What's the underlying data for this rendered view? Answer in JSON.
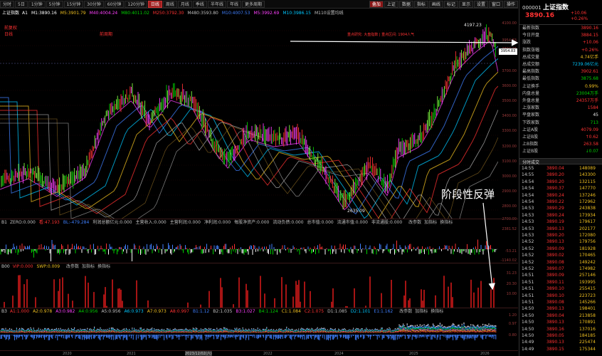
{
  "toolbar": {
    "periods": [
      "分时",
      "5日",
      "1分钟",
      "5分钟",
      "15分钟",
      "30分钟",
      "60分钟",
      "120分钟",
      "日线",
      "周线",
      "月线",
      "季线",
      "半年线",
      "年线",
      "更多周期"
    ],
    "active_period": "日线",
    "right_buttons": [
      "叠加",
      "上证",
      "数据",
      "指标",
      "画线",
      "标记",
      "显示",
      "设置",
      "窗口",
      "操作"
    ]
  },
  "ma_line": {
    "title": "上证指数",
    "items": [
      {
        "label": "A1",
        "value": "",
        "color": "#ffffff"
      },
      {
        "label": "M1:3890.16",
        "color": "#ffffff"
      },
      {
        "label": "M5:3901.79",
        "color": "#f0c020"
      },
      {
        "label": "M40:4004.24",
        "color": "#ff40ff"
      },
      {
        "label": "M80:4011.02",
        "color": "#00d000"
      },
      {
        "label": "M250:3792.30",
        "color": "#ff3232"
      },
      {
        "label": "M480:3593.80",
        "color": "#c0c0c0"
      },
      {
        "label": "M10:4007.53",
        "color": "#4080ff"
      },
      {
        "label": "M5:3992.69",
        "color": "#ff40ff"
      },
      {
        "label": "M10:3986.15",
        "color": "#00c8ff"
      },
      {
        "label": "M110设置均线",
        "color": "#c0c0c0"
      }
    ]
  },
  "main_chart": {
    "left_labels": [
      "前复权",
      "日线",
      "前周期"
    ],
    "top_annotations": [
      {
        "text": "4197.23",
        "color": "#ffffff"
      },
      {
        "text": "重点研究: 大盘指数 | 重点区间: 1904人气",
        "color": "#ff3232"
      }
    ],
    "low_annotation": "2635.09",
    "y_ticks": [
      "4100.00",
      "3954.83",
      "3890.16",
      "3700.00",
      "3600.00",
      "3500.00",
      "3400.00",
      "3300.00",
      "3200.00",
      "3100.00",
      "3000.00",
      "2900.00",
      "2800.00",
      "2700.00"
    ],
    "price_badge": "3954.83",
    "current_price_label": "3890.16",
    "annotation_text": "阶段性反弹"
  },
  "panel_b1": {
    "label": "B1",
    "items": [
      {
        "label": "ZERO:0.000",
        "color": "#c0c0c0"
      },
      {
        "label": "看:47.193",
        "color": "#ff3232"
      },
      {
        "label": "BL:-479.284",
        "color": "#4080ff"
      },
      {
        "label": "利润总额亿元:0.000",
        "color": "#c0c0c0"
      },
      {
        "label": "主营收入:0.000",
        "color": "#c0c0c0"
      },
      {
        "label": "主营利润:0.000",
        "color": "#c0c0c0"
      },
      {
        "label": "净利润:0.000",
        "color": "#c0c0c0"
      },
      {
        "label": "每股净资产:0.000",
        "color": "#c0c0c0"
      },
      {
        "label": "流动负债:0.000",
        "color": "#c0c0c0"
      },
      {
        "label": "总市值:0.000",
        "color": "#c0c0c0"
      },
      {
        "label": "流通市值:0.000",
        "color": "#c0c0c0"
      },
      {
        "label": "非流通股:0.000",
        "color": "#c0c0c0"
      }
    ],
    "controls": [
      "改参数",
      "加指标",
      "换指标"
    ],
    "y_ticks": [
      "2381.52",
      "-53.21",
      "-1140.02"
    ]
  },
  "panel_b00": {
    "label": "B00",
    "items": [
      {
        "label": "VIP:0.000",
        "color": "#ff3232"
      },
      {
        "label": "SWP:0.009",
        "color": "#f0c020"
      }
    ],
    "controls": [
      "改参数",
      "加指标",
      "换指标"
    ],
    "y_ticks": [
      "31.23",
      "20.30",
      "10.00"
    ]
  },
  "panel_b3": {
    "label": "B3",
    "items": [
      {
        "label": "A1:1.000",
        "color": "#ff3232"
      },
      {
        "label": "A2:0.978",
        "color": "#f0c020"
      },
      {
        "label": "A3:0.982",
        "color": "#ff40ff"
      },
      {
        "label": "A4:0.956",
        "color": "#00d000"
      },
      {
        "label": "A5:0.956",
        "color": "#c0c0c0"
      },
      {
        "label": "A6:0.973",
        "color": "#00c8ff"
      },
      {
        "label": "A7:0.973",
        "color": "#f0c020"
      },
      {
        "label": "A8:0.997",
        "color": "#ff3232"
      },
      {
        "label": "B1:1.12",
        "color": "#4080ff"
      },
      {
        "label": "B2:1.035",
        "color": "#c0c0c0"
      },
      {
        "label": "B3:1.027",
        "color": "#ff40ff"
      },
      {
        "label": "B4:1.124",
        "color": "#00d000"
      },
      {
        "label": "C1:1.084",
        "color": "#f0c020"
      },
      {
        "label": "C2:1.075",
        "color": "#ff3232"
      },
      {
        "label": "D1:1.085",
        "color": "#c0c0c0"
      },
      {
        "label": "D2:1.101",
        "color": "#00c8ff"
      },
      {
        "label": "E1:1.162",
        "color": "#4080ff"
      }
    ],
    "controls": [
      "改参数",
      "加指标",
      "换指标"
    ],
    "y_ticks": [
      "1.20",
      "0.97",
      "0.80"
    ]
  },
  "x_axis_labels": [
    "2020",
    "2021",
    "2023/12/02(六)",
    "2022",
    "2024",
    "2025",
    "2026"
  ],
  "quote": {
    "code": "000001",
    "name": "上证指数",
    "price": "3890.16",
    "change": "+10.06",
    "change_pct": "+0.26%",
    "rows": [
      {
        "k": "最新指数",
        "v": "3890.16",
        "c": "red"
      },
      {
        "k": "今日开盘",
        "v": "3884.15",
        "c": "red"
      },
      {
        "k": "涨跌",
        "v": "+10.06",
        "c": "red"
      },
      {
        "k": "指数涨幅",
        "v": "+0.26%",
        "c": "red"
      },
      {
        "k": "总成交量",
        "v": "4.74亿手",
        "c": "yellow"
      },
      {
        "k": "总成交额",
        "v": "7239.06亿元",
        "c": "cyan"
      },
      {
        "k": "最高指数",
        "v": "3902.61",
        "c": "red"
      },
      {
        "k": "最低指数",
        "v": "3875.68",
        "c": "green"
      },
      {
        "k": "上证换手",
        "v": "0.99%",
        "c": "yellow"
      },
      {
        "k": "内盘总量",
        "v": "23004万手",
        "c": "green"
      },
      {
        "k": "外盘总量",
        "v": "24357万手",
        "c": "red"
      },
      {
        "k": "上涨家数",
        "v": "1584",
        "c": "red"
      },
      {
        "k": "平盘家数",
        "v": "45",
        "c": "white"
      },
      {
        "k": "下跌家数",
        "v": "713",
        "c": "green"
      },
      {
        "k": "上证A股",
        "v": "4079.09",
        "c": "red"
      },
      {
        "k": "上证B股",
        "v": "↑0.62",
        "c": "red"
      },
      {
        "k": "上B指数",
        "v": "263.58",
        "c": "red"
      },
      {
        "k": "上证B股",
        "v": "↓0.07",
        "c": "green"
      }
    ],
    "ticks_title": "分时成交",
    "ticks": [
      {
        "t": "14:55",
        "p": "3890.04",
        "v": "148089"
      },
      {
        "t": "14:55",
        "p": "3890.20",
        "v": "143300"
      },
      {
        "t": "14:54",
        "p": "3890.20",
        "v": "132115"
      },
      {
        "t": "14:54",
        "p": "3890.37",
        "v": "147770"
      },
      {
        "t": "14:54",
        "p": "3890.24",
        "v": "137246"
      },
      {
        "t": "14:54",
        "p": "3890.22",
        "v": "172962"
      },
      {
        "t": "14:53",
        "p": "3890.29",
        "v": "243838"
      },
      {
        "t": "14:53",
        "p": "3890.24",
        "v": "173934"
      },
      {
        "t": "14:53",
        "p": "3890.19",
        "v": "179617"
      },
      {
        "t": "14:53",
        "p": "3890.13",
        "v": "202177"
      },
      {
        "t": "14:53",
        "p": "3890.20",
        "v": "172080"
      },
      {
        "t": "14:52",
        "p": "3890.13",
        "v": "179756"
      },
      {
        "t": "14:52",
        "p": "3890.09",
        "v": "181928"
      },
      {
        "t": "14:52",
        "p": "3890.02",
        "v": "170465"
      },
      {
        "t": "14:52",
        "p": "3890.08",
        "v": "149242"
      },
      {
        "t": "14:52",
        "p": "3890.07",
        "v": "174982"
      },
      {
        "t": "14:51",
        "p": "3890.09",
        "v": "257146"
      },
      {
        "t": "14:51",
        "p": "3890.11",
        "v": "193995"
      },
      {
        "t": "14:51",
        "p": "3890.10",
        "v": "255415"
      },
      {
        "t": "14:51",
        "p": "3890.10",
        "v": "223723"
      },
      {
        "t": "14:51",
        "p": "3890.08",
        "v": "145266"
      },
      {
        "t": "14:50",
        "p": "3890.13",
        "v": "198401"
      },
      {
        "t": "14:50",
        "p": "3890.04",
        "v": "213858"
      },
      {
        "t": "14:50",
        "p": "3890.13",
        "v": "170891"
      },
      {
        "t": "14:50",
        "p": "3890.16",
        "v": "137016"
      },
      {
        "t": "14:50",
        "p": "3890.05",
        "v": "184185"
      },
      {
        "t": "14:49",
        "p": "3890.13",
        "v": "225474"
      },
      {
        "t": "14:49",
        "p": "3890.15",
        "v": "175344"
      }
    ]
  }
}
